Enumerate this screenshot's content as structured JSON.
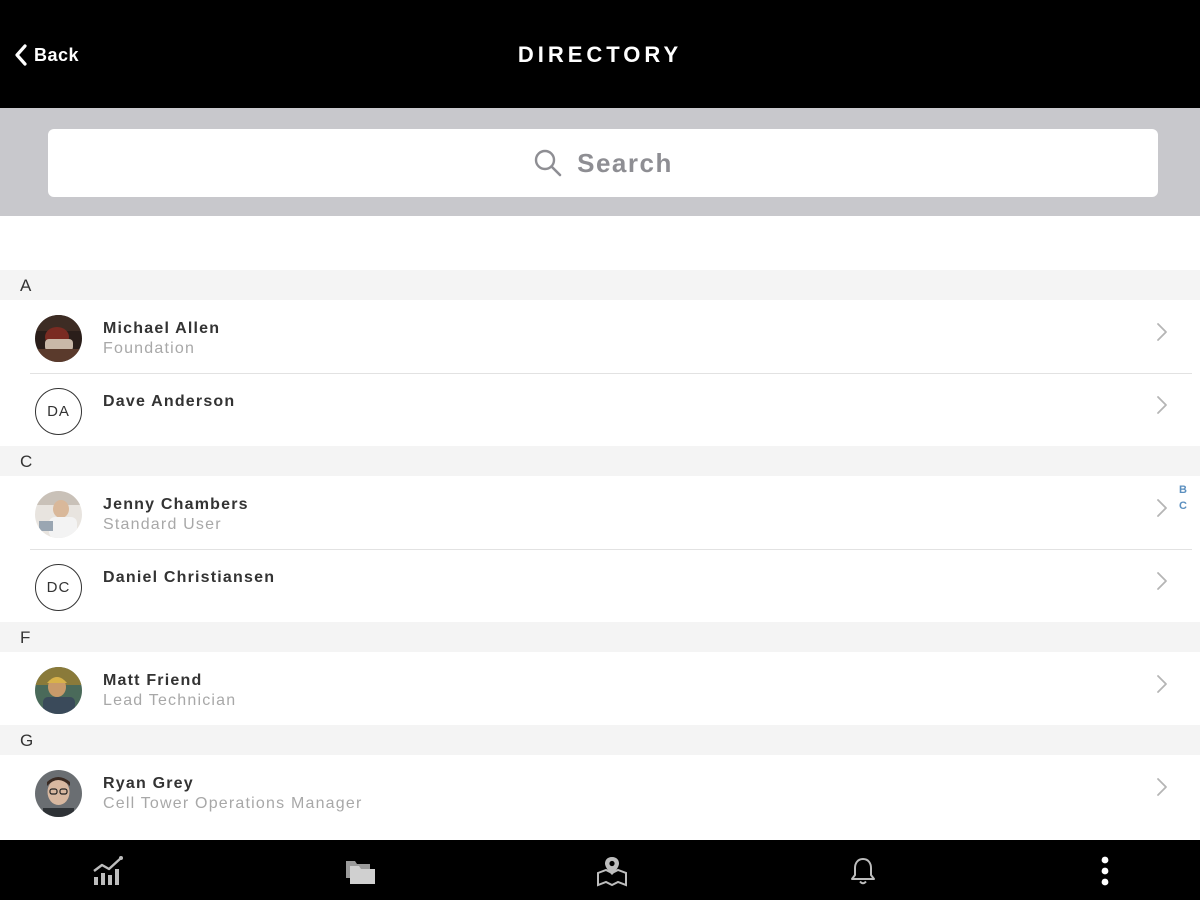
{
  "header": {
    "back_label": "Back",
    "title": "DIRECTORY"
  },
  "search": {
    "placeholder": "Search"
  },
  "sections": [
    {
      "letter": "A",
      "contacts": [
        {
          "name": "Michael Allen",
          "subtitle": "Foundation",
          "avatar": "photo"
        },
        {
          "name": "Dave Anderson",
          "subtitle": "",
          "avatar": "initials",
          "initials": "DA"
        }
      ]
    },
    {
      "letter": "C",
      "contacts": [
        {
          "name": "Jenny Chambers",
          "subtitle": "Standard User",
          "avatar": "photo"
        },
        {
          "name": "Daniel Christiansen",
          "subtitle": "",
          "avatar": "initials",
          "initials": "DC"
        }
      ]
    },
    {
      "letter": "F",
      "contacts": [
        {
          "name": "Matt Friend",
          "subtitle": "Lead Technician",
          "avatar": "photo"
        }
      ]
    },
    {
      "letter": "G",
      "contacts": [
        {
          "name": "Ryan Grey",
          "subtitle": "Cell Tower Operations Manager",
          "avatar": "photo"
        }
      ]
    }
  ],
  "section_index": [
    "B",
    "C"
  ],
  "bottom_tabs": [
    {
      "icon": "analytics-chart-icon"
    },
    {
      "icon": "folders-icon"
    },
    {
      "icon": "map-icon"
    },
    {
      "icon": "bell-icon"
    },
    {
      "icon": "more-vertical-icon"
    }
  ],
  "colors": {
    "bar_background": "#000000",
    "search_tray": "#c8c8cc",
    "section_header": "#f4f4f4",
    "index_accent": "#5b8fbf"
  }
}
